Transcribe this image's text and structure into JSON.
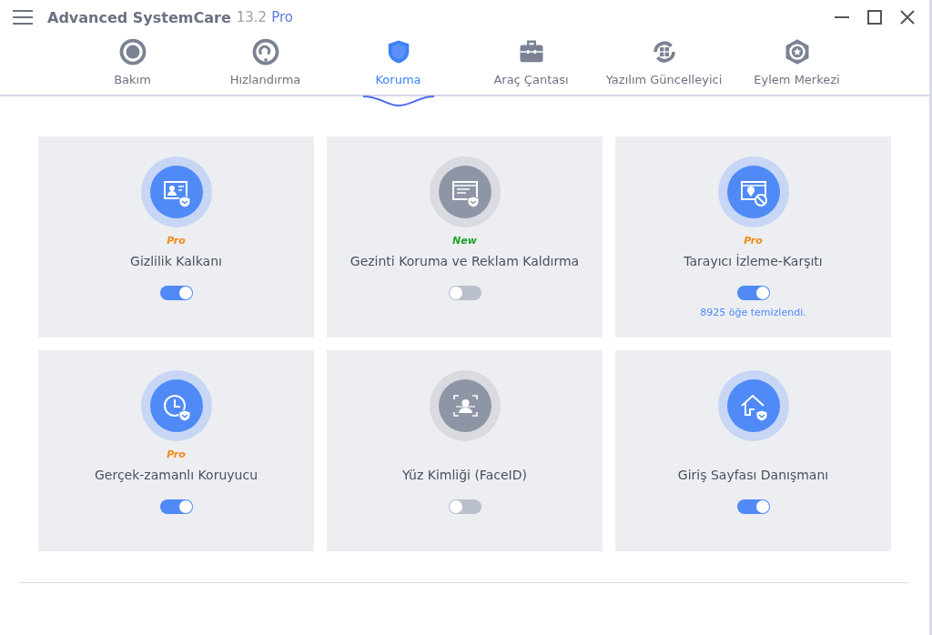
{
  "window": {
    "title": "Advanced SystemCare",
    "version": "13.2",
    "edition": "Pro"
  },
  "tabs": [
    {
      "label": "Bakım",
      "selected": false
    },
    {
      "label": "Hızlandırma",
      "selected": false
    },
    {
      "label": "Koruma",
      "selected": true
    },
    {
      "label": "Araç Çantası",
      "selected": false
    },
    {
      "label": "Yazılım Güncelleyici",
      "selected": false
    },
    {
      "label": "Eylem Merkezi",
      "selected": false
    }
  ],
  "cards": [
    {
      "badge": {
        "text": "Pro",
        "kind": "pro"
      },
      "title": "Gizlilik Kalkanı",
      "on": true
    },
    {
      "badge": {
        "text": "New",
        "kind": "new"
      },
      "title": "Gezinti Koruma ve Reklam Kaldırma",
      "on": false
    },
    {
      "badge": {
        "text": "Pro",
        "kind": "pro"
      },
      "title": "Tarayıcı İzleme-Karşıtı",
      "on": true,
      "note": "8925 öğe temizlendi."
    },
    {
      "badge": {
        "text": "Pro",
        "kind": "pro"
      },
      "title": "Gerçek-zamanlı Koruyucu",
      "on": true
    },
    {
      "title": "Yüz Kimliği (FaceID)",
      "on": false
    },
    {
      "title": "Giriş Sayfası Danışmanı",
      "on": true
    }
  ]
}
